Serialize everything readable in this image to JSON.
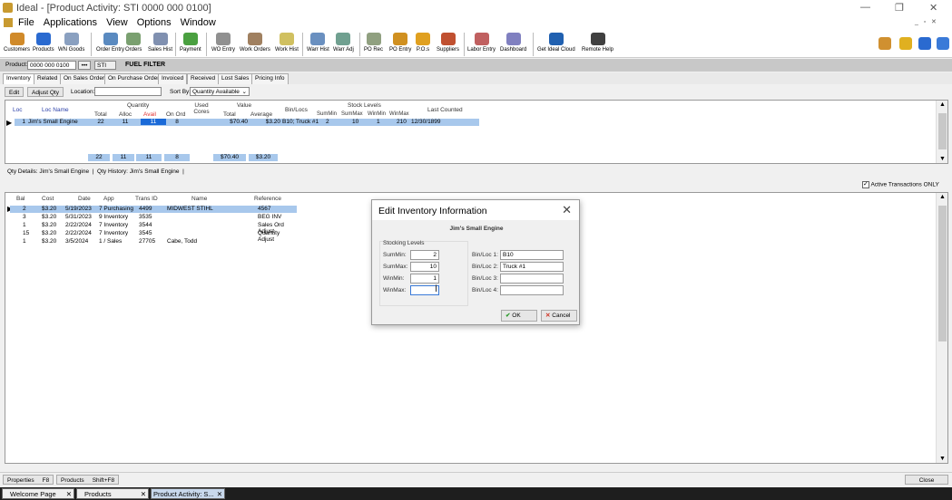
{
  "window": {
    "title": "Ideal - [Product Activity:  STI 0000 000 0100]",
    "minimize": "—",
    "restore": "❐",
    "close": "✕"
  },
  "menu": [
    "File",
    "Applications",
    "View",
    "Options",
    "Window"
  ],
  "toolbar": [
    {
      "label": "Customers",
      "color": "#d08a2a"
    },
    {
      "label": "Products",
      "color": "#2a6ad0"
    },
    {
      "label": "WN Goods",
      "color": "#8aa0c0"
    },
    {
      "label": "Order Entry",
      "color": "#5a8ac0"
    },
    {
      "label": "Orders",
      "color": "#7aa070"
    },
    {
      "label": "Sales Hist",
      "color": "#8090b0"
    },
    {
      "label": "Payment",
      "color": "#4aa040"
    },
    {
      "label": "WO Entry",
      "color": "#909090"
    },
    {
      "label": "Work Orders",
      "color": "#a08060"
    },
    {
      "label": "Work Hist",
      "color": "#d0c060"
    },
    {
      "label": "Warr Hist",
      "color": "#6a90c0"
    },
    {
      "label": "Warr Adj",
      "color": "#70a090"
    },
    {
      "label": "PO Rec",
      "color": "#90a080"
    },
    {
      "label": "PO Entry",
      "color": "#d09020"
    },
    {
      "label": "P.O.s",
      "color": "#e0a020"
    },
    {
      "label": "Suppliers",
      "color": "#c05030"
    },
    {
      "label": "Labor Entry",
      "color": "#c06060"
    },
    {
      "label": "Dashboard",
      "color": "#8080c0"
    },
    {
      "label": "Get Ideal Cloud",
      "color": "#2060b0"
    },
    {
      "label": "Remote Help",
      "color": "#404040"
    }
  ],
  "product_bar": {
    "label": "Product:",
    "number": "0000 000 0100",
    "browse": "•••",
    "supplier": "STI",
    "description": "FUEL FILTER"
  },
  "tabs": [
    "Inventory",
    "Related",
    "On Sales Order",
    "On Purchase Order",
    "Invoiced",
    "Received",
    "Lost Sales",
    "Pricing Info"
  ],
  "actions": {
    "edit": "Edit",
    "adjust": "Adjust Qty",
    "location_label": "Location:",
    "location_value": "",
    "sort_label": "Sort By:",
    "sort_value": "Quantity Available"
  },
  "inventory_grid": {
    "headers": {
      "loc": "Loc",
      "loc_name": "Loc Name",
      "quantity": "Quantity",
      "total": "Total",
      "alloc": "Alloc",
      "avail": "Avail",
      "on_ord": "On Ord",
      "used_cores": "Used Cores",
      "value": "Value",
      "vtotal": "Total",
      "average": "Average",
      "bin_locs": "Bin/Locs",
      "stock_levels": "Stock Levels",
      "summin": "SumMin",
      "summax": "SumMax",
      "winmin": "WinMin",
      "winmax": "WinMax",
      "last_counted": "Last Counted"
    },
    "row": {
      "loc": "1",
      "loc_name": "Jim's Small Engine",
      "total": "22",
      "alloc": "11",
      "avail": "11",
      "on_ord": "8",
      "value_total": "$70.40",
      "average": "$3.20",
      "bin_locs": "B10; Truck #1",
      "summin": "2",
      "summax": "10",
      "winmin": "1",
      "winmax": "210",
      "last_counted": "12/30/1899"
    },
    "totals": {
      "total": "22",
      "alloc": "11",
      "avail": "11",
      "on_ord": "8",
      "value_total": "$70.40",
      "average": "$3.20"
    }
  },
  "subtabs": [
    "Qty Details: Jim's Small Engine",
    "Qty History: Jim's Small Engine"
  ],
  "active_only": "Active Transactions ONLY",
  "history_grid": {
    "headers": [
      "Bal",
      "Cost",
      "Date",
      "App",
      "Trans ID",
      "Name",
      "Reference"
    ],
    "rows": [
      [
        "2",
        "$3.20",
        "5/19/2023",
        "7 Purchasing",
        "4499",
        "MIDWEST STIHL",
        "4567"
      ],
      [
        "3",
        "$3.20",
        "5/31/2023",
        "9 Inventory",
        "3535",
        "",
        "BEG INV"
      ],
      [
        "1",
        "$3.20",
        "2/22/2024",
        "7 Inventory",
        "3544",
        "",
        "Sales Ord Adjust"
      ],
      [
        "15",
        "$3.20",
        "2/22/2024",
        "7 Inventory",
        "3545",
        "",
        "Quantity Adjust"
      ],
      [
        "1",
        "$3.20",
        "3/5/2024",
        "1 / Sales",
        "27705",
        "Cabe, Todd",
        ""
      ]
    ]
  },
  "dialog": {
    "title": "Edit Inventory Information",
    "subtitle": "Jim's Small Engine",
    "group": "Stocking Levels",
    "summin_label": "SumMin:",
    "summin": "2",
    "summax_label": "SumMax:",
    "summax": "10",
    "winmin_label": "WinMin:",
    "winmin": "1",
    "winmax_label": "WinMax:",
    "winmax": "",
    "bin1_label": "Bin/Loc 1:",
    "bin1": "B10",
    "bin2_label": "Bin/Loc 2:",
    "bin2": "Truck #1",
    "bin3_label": "Bin/Loc 3:",
    "bin3": "",
    "bin4_label": "Bin/Loc 4:",
    "bin4": "",
    "ok": "OK",
    "cancel": "Cancel"
  },
  "statusbar": {
    "properties": "Properties",
    "properties_key": "F8",
    "products": "Products",
    "products_key": "Shift+F8",
    "close": "Close"
  },
  "doc_tabs": [
    "Welcome Page",
    "Products",
    "Product Activity: S..."
  ]
}
